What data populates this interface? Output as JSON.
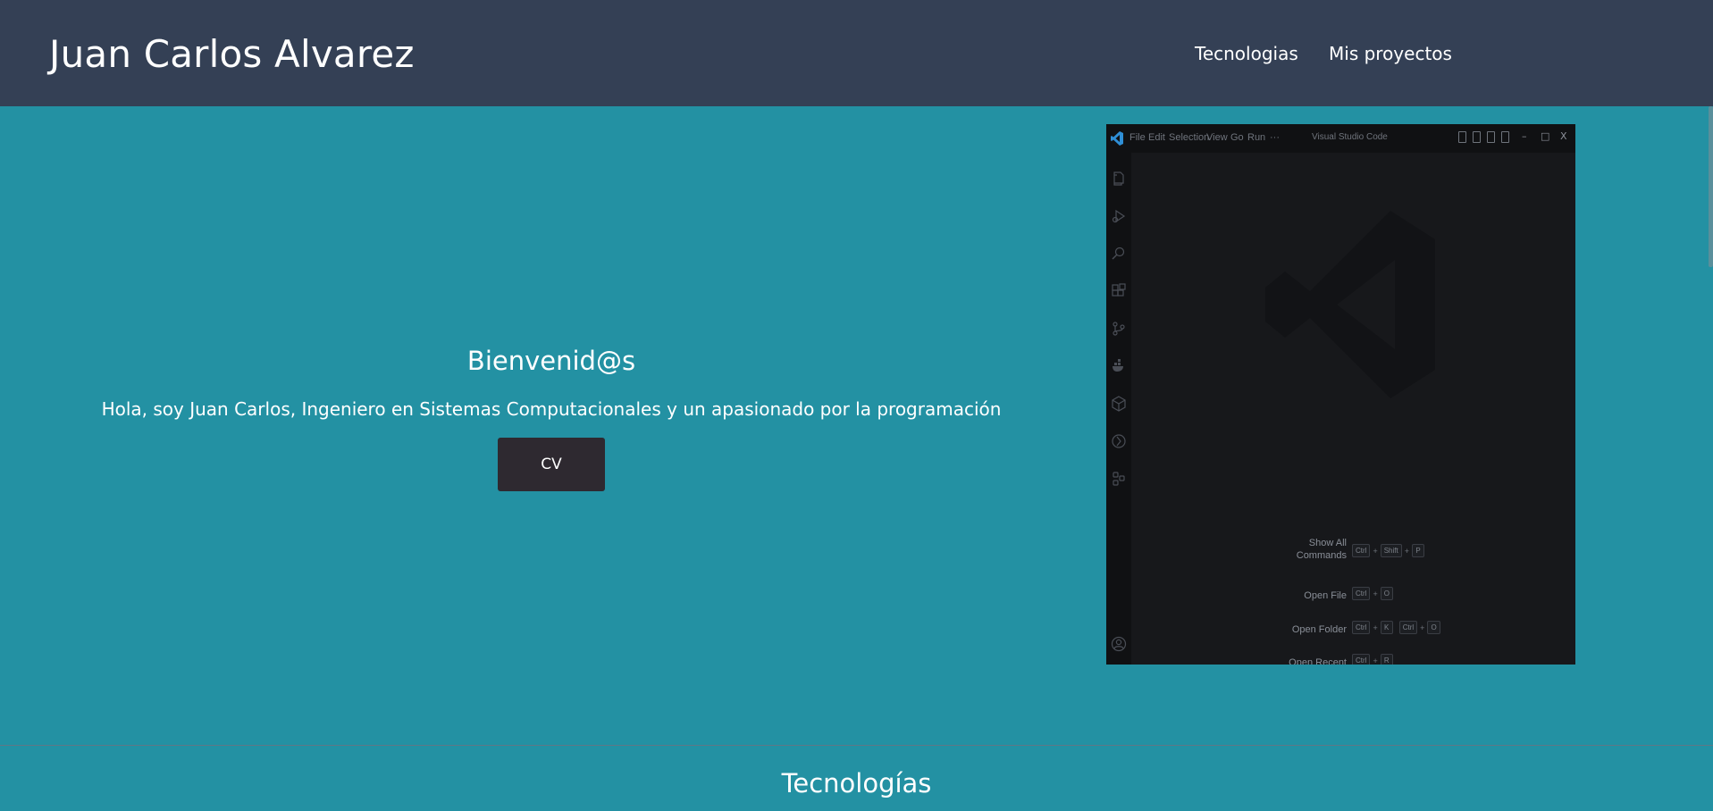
{
  "header": {
    "brand": "Juan Carlos Alvarez",
    "nav": [
      "Tecnologias",
      "Mis proyectos"
    ]
  },
  "hero": {
    "title": "Bienvenid@s",
    "subtitle": "Hola, soy Juan Carlos, Ingeniero en Sistemas Computacionales y un apasionado por la programación",
    "button_label": "CV"
  },
  "vscode_image": {
    "menu": [
      "File",
      "Edit",
      "Selection",
      "View",
      "Go",
      "Run",
      "···"
    ],
    "window_title": "Visual Studio Code",
    "window_controls": [
      "–",
      "□",
      "X"
    ],
    "activity_icons": [
      "explorer-icon",
      "run-debug-icon",
      "search-icon",
      "extensions-icon",
      "source-control-icon",
      "docker-icon",
      "package-icon",
      "git-graph-icon",
      "remote-icon",
      "account-icon"
    ],
    "shortcuts": [
      {
        "label": "Show All\nCommands",
        "keys": [
          "Ctrl",
          "+",
          "Shift",
          "+",
          "P"
        ]
      },
      {
        "label": "Open File",
        "keys": [
          "Ctrl",
          "+",
          "O"
        ]
      },
      {
        "label": "Open Folder",
        "keys": [
          "Ctrl",
          "+",
          "K",
          "Ctrl",
          "+",
          "O"
        ]
      },
      {
        "label": "Open Recent",
        "keys": [
          "Ctrl",
          "+",
          "R"
        ]
      }
    ]
  },
  "section": {
    "title": "Tecnologías"
  },
  "colors": {
    "header_bg": "#344055",
    "page_bg": "#2391a3",
    "button_bg": "#2e2930",
    "vscode_bg": "#17181b"
  }
}
